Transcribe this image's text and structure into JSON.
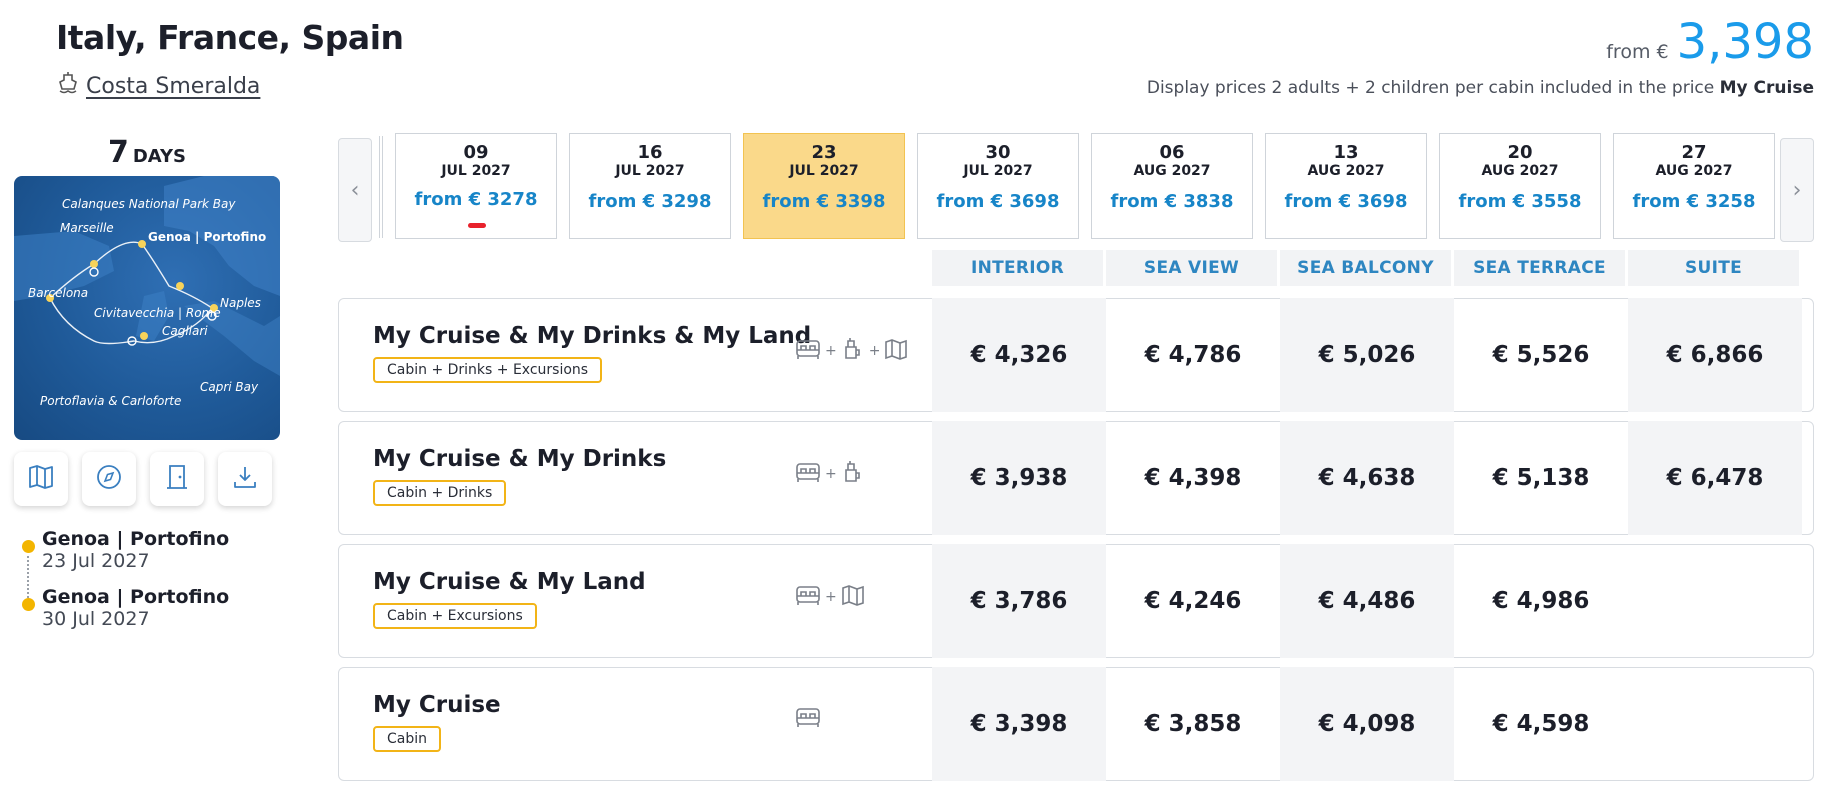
{
  "header": {
    "title": "Italy, France, Spain",
    "ship_name": "Costa Smeralda",
    "from_label": "from €",
    "price": "3,398",
    "note_prefix": "Display prices 2 adults + 2 children per cabin included in the price",
    "note_bold": "My Cruise"
  },
  "sidebar": {
    "days_number": "7",
    "days_label": "DAYS",
    "map_labels": {
      "calanques": "Calanques National Park Bay",
      "marseille": "Marseille",
      "genoa": "Genoa | Portofino",
      "barcelona": "Barcelona",
      "naples": "Naples",
      "civitavecchia": "Civitavecchia | Rome",
      "cagliari": "Cagliari",
      "capri": "Capri Bay",
      "portoflavia": "Portoflavia & Carloforte"
    },
    "tools": [
      "map-icon",
      "compass-icon",
      "door-icon",
      "download-icon"
    ],
    "itinerary": [
      {
        "port": "Genoa | Portofino",
        "date": "23 Jul 2027"
      },
      {
        "port": "Genoa | Portofino",
        "date": "30 Jul 2027"
      }
    ]
  },
  "dates": [
    {
      "day": "09",
      "month_year": "JUL 2027",
      "price": "from € 3278",
      "selected": false
    },
    {
      "day": "16",
      "month_year": "JUL 2027",
      "price": "from € 3298",
      "selected": false
    },
    {
      "day": "23",
      "month_year": "JUL 2027",
      "price": "from € 3398",
      "selected": true
    },
    {
      "day": "30",
      "month_year": "JUL 2027",
      "price": "from € 3698",
      "selected": false
    },
    {
      "day": "06",
      "month_year": "AUG 2027",
      "price": "from € 3838",
      "selected": false
    },
    {
      "day": "13",
      "month_year": "AUG 2027",
      "price": "from € 3698",
      "selected": false
    },
    {
      "day": "20",
      "month_year": "AUG 2027",
      "price": "from € 3558",
      "selected": false
    },
    {
      "day": "27",
      "month_year": "AUG 2027",
      "price": "from € 3258",
      "selected": false
    }
  ],
  "columns": [
    "INTERIOR",
    "SEA VIEW",
    "SEA BALCONY",
    "SEA TERRACE",
    "SUITE"
  ],
  "packages": [
    {
      "name": "My Cruise & My Drinks & My Land",
      "badge": "Cabin + Drinks + Excursions",
      "icons": [
        "bed-icon",
        "drink-icon",
        "map-icon"
      ],
      "prices": [
        "€ 4,326",
        "€ 4,786",
        "€ 5,026",
        "€ 5,526",
        "€ 6,866"
      ]
    },
    {
      "name": "My Cruise & My Drinks",
      "badge": "Cabin + Drinks",
      "icons": [
        "bed-icon",
        "drink-icon"
      ],
      "prices": [
        "€ 3,938",
        "€ 4,398",
        "€ 4,638",
        "€ 5,138",
        "€ 6,478"
      ]
    },
    {
      "name": "My Cruise & My Land",
      "badge": "Cabin + Excursions",
      "icons": [
        "bed-icon",
        "map-icon"
      ],
      "prices": [
        "€ 3,786",
        "€ 4,246",
        "€ 4,486",
        "€ 4,986",
        ""
      ]
    },
    {
      "name": "My Cruise",
      "badge": "Cabin",
      "icons": [
        "bed-icon"
      ],
      "prices": [
        "€ 3,398",
        "€ 3,858",
        "€ 4,098",
        "€ 4,598",
        ""
      ]
    }
  ],
  "colors": {
    "accent_blue": "#1a9bea",
    "selected_date": "#fad98a",
    "badge_border": "#f2b417",
    "itinerary_dot": "#f3b500"
  }
}
